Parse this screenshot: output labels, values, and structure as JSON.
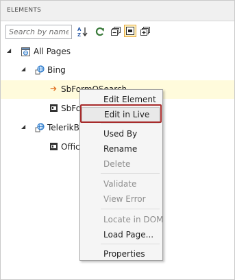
{
  "panel": {
    "title": "ELEMENTS"
  },
  "search": {
    "placeholder": "Search by name"
  },
  "toolbar": {
    "buttons": [
      {
        "name": "sort-az-icon"
      },
      {
        "name": "refresh-icon"
      },
      {
        "name": "collapse-all-icon"
      },
      {
        "name": "toggle-view-icon",
        "active": true
      },
      {
        "name": "expand-all-icon"
      }
    ]
  },
  "tree": {
    "root": "All Pages",
    "page1": "Bing",
    "element1": "SbFormQSearch",
    "element2": "SbFo",
    "page2": "TelerikBir",
    "element3": "Offic"
  },
  "context_menu": {
    "items": [
      {
        "label": "Edit Element",
        "enabled": true
      },
      {
        "label": "Edit in Live",
        "enabled": true,
        "highlighted": true
      },
      {
        "label": "Used By",
        "enabled": true
      },
      {
        "label": "Rename",
        "enabled": true
      },
      {
        "label": "Delete",
        "enabled": false
      },
      {
        "label": "Validate",
        "enabled": false
      },
      {
        "label": "View Error",
        "enabled": false
      },
      {
        "label": "Locate in DOM",
        "enabled": false
      },
      {
        "label": "Load Page...",
        "enabled": true
      },
      {
        "label": "Properties",
        "enabled": true
      }
    ]
  },
  "colors": {
    "selection_row": "#fffbdc",
    "callout_border": "#a72b2b",
    "active_button_border": "#e5a83d",
    "arrow_orange": "#e07020",
    "globe_blue": "#2a78c8"
  }
}
